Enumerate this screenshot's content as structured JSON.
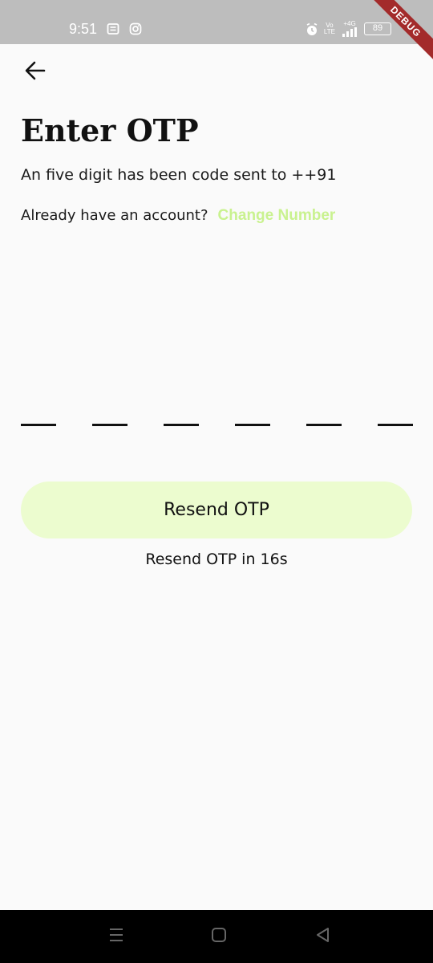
{
  "status_bar": {
    "time": "9:51",
    "left_icons": [
      "notes-icon",
      "instagram-icon"
    ],
    "right_icons": [
      "alarm-icon",
      "volte-icon",
      "signal-4g-icon",
      "battery-icon"
    ],
    "network_top": "Vo",
    "network_bottom": "LTE",
    "network_type": "+4G",
    "battery": "89"
  },
  "debug_banner": "DEBUG",
  "header": {
    "title": "Enter OTP"
  },
  "info": {
    "subtitle": "An five digit has been code sent to ++91",
    "account_prompt": "Already have an account?",
    "change_number_label": "Change Number"
  },
  "otp": {
    "digits": [
      "",
      "",
      "",
      "",
      "",
      ""
    ]
  },
  "resend": {
    "button_label": "Resend OTP",
    "timer_text": "Resend OTP in 16s"
  },
  "colors": {
    "link": "#c9f28f",
    "button_bg": "#ecfccf",
    "background": "#fafafa",
    "status_bar": "#bdbdbd"
  }
}
